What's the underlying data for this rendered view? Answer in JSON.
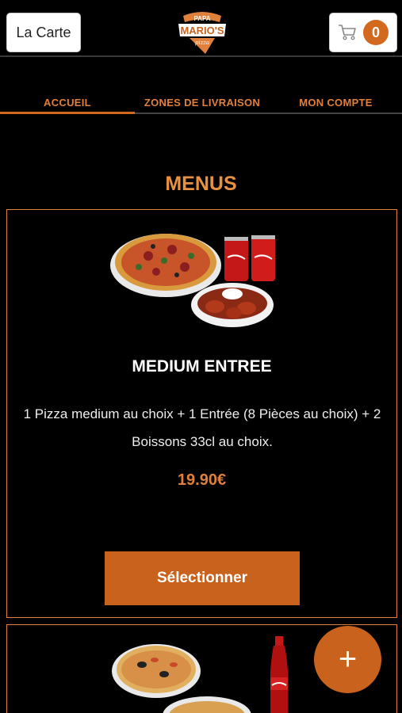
{
  "header": {
    "carte_label": "La Carte",
    "logo": {
      "top_text": "PAPA",
      "main_text": "MARIO'S",
      "sub_text": "pizza"
    },
    "cart_count": "0"
  },
  "tabs": [
    {
      "label": "ACCUEIL",
      "active": true
    },
    {
      "label": "ZONES DE LIVRAISON",
      "active": false
    },
    {
      "label": "MON COMPTE",
      "active": false
    }
  ],
  "section_title": "MENUS",
  "menus": [
    {
      "name": "MEDIUM ENTREE",
      "description": "1 Pizza medium au choix + 1 Entrée (8 Pièces au choix) + 2 Boissons 33cl au choix.",
      "price": "19.90€",
      "button_label": "Sélectionner",
      "image_icons": [
        "pizza-icon",
        "coca-cola-can-icon",
        "chicken-wings-icon"
      ]
    },
    {
      "image_icons": [
        "pizza-icon",
        "coca-cola-bottle-icon"
      ]
    }
  ],
  "fab_label": "+",
  "colors": {
    "accent": "#d2691e",
    "accent_text": "#e0803a",
    "background": "#000000"
  }
}
